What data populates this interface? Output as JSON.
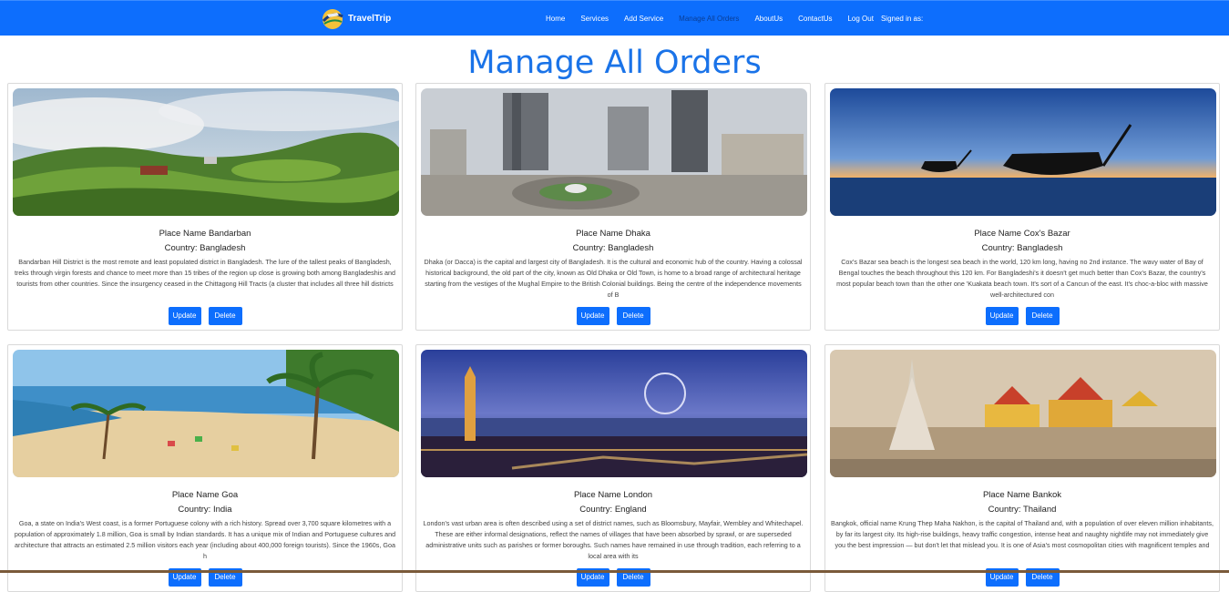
{
  "nav": {
    "brand": "TravelTrip",
    "links": [
      "Home",
      "Services",
      "Add Service",
      "Manage All Orders",
      "AboutUs",
      "ContactUs",
      "Log Out",
      "Signed in as:"
    ],
    "colors": {
      "bar": "#0d6efd",
      "active_link": "#0a3e96"
    }
  },
  "page": {
    "title": "Manage All Orders"
  },
  "cards": [
    {
      "place": "Place Name Bandarban",
      "country": "Country: Bangladesh",
      "desc": "Bandarban Hill District is the most remote and least populated district in Bangladesh. The lure of the tallest peaks of Bangladesh, treks through virgin forests and chance to meet more than 15 tribes of the region up close is growing both among Bangladeshis and tourists from other countries. Since the insurgency ceased in the Chittagong Hill Tracts (a cluster that includes all three hill districts",
      "update": "Update",
      "delete": "Delete"
    },
    {
      "place": "Place Name Dhaka",
      "country": "Country: Bangladesh",
      "desc": "Dhaka (or Dacca) is the capital and largest city of Bangladesh. It is the cultural and economic hub of the country. Having a colossal historical background, the old part of the city, known as Old Dhaka or Old Town, is home to a broad range of architectural heritage starting from the vestiges of the Mughal Empire to the British Colonial buildings. Being the centre of the independence movements of B",
      "update": "Update",
      "delete": "Delete"
    },
    {
      "place": "Place Name Cox's Bazar",
      "country": "Country: Bangladesh",
      "desc": "Cox's Bazar sea beach is the longest sea beach in the world, 120 km long, having no 2nd instance. The wavy water of Bay of Bengal touches the beach throughout this 120 km. For Bangladeshi's it doesn't get much better than Cox's Bazar, the country's most popular beach town than the other one 'Kuakata beach town. It's sort of a Cancun of the east. It's choc-a-bloc with massive well-architectured con",
      "update": "Update",
      "delete": "Delete"
    },
    {
      "place": "Place Name Goa",
      "country": "Country: India",
      "desc": "Goa, a state on India's West coast, is a former Portuguese colony with a rich history. Spread over 3,700 square kilometres with a population of approximately 1.8 million, Goa is small by Indian standards. It has a unique mix of Indian and Portuguese cultures and architecture that attracts an estimated 2.5 million visitors each year (including about 400,000 foreign tourists). Since the 1960s, Goa h",
      "update": "Update",
      "delete": "Delete"
    },
    {
      "place": "Place Name London",
      "country": "Country: England",
      "desc": "London's vast urban area is often described using a set of district names, such as Bloomsbury, Mayfair, Wembley and Whitechapel. These are either informal designations, reflect the names of villages that have been absorbed by sprawl, or are superseded administrative units such as parishes or former boroughs. Such names have remained in use through tradition, each referring to a local area with its",
      "update": "Update",
      "delete": "Delete"
    },
    {
      "place": "Place Name Bankok",
      "country": "Country: Thailand",
      "desc": "Bangkok, official name Krung Thep Maha Nakhon, is the capital of Thailand and, with a population of over eleven million inhabitants, by far its largest city. Its high-rise buildings, heavy traffic congestion, intense heat and naughty nightlife may not immediately give you the best impression — but don't let that mislead you. It is one of Asia's most cosmopolitan cities with magnificent temples and",
      "update": "Update",
      "delete": "Delete"
    }
  ]
}
